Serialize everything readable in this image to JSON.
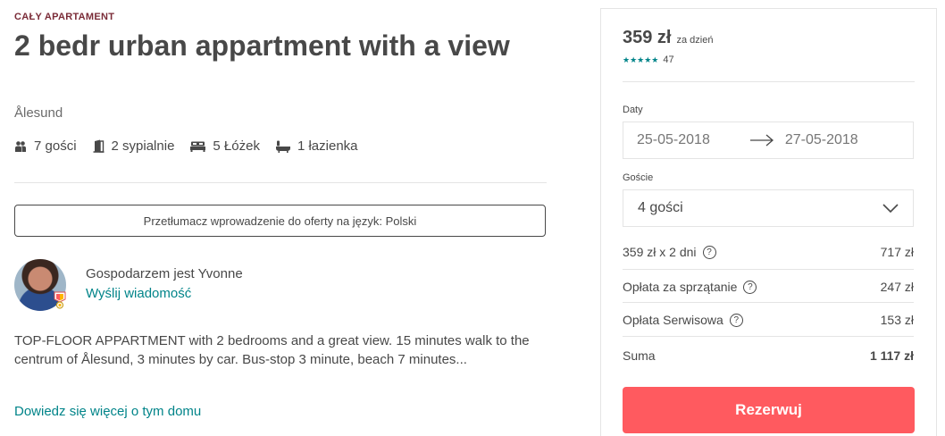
{
  "listing": {
    "type": "CAŁY APARTAMENT",
    "title": "2 bedr urban appartment with a view",
    "city": "Ålesund",
    "facts": {
      "guests": "7 gości",
      "bedrooms": "2 sypialnie",
      "beds": "5 Łóżek",
      "bathrooms": "1 łazienka"
    },
    "translate_label": "Przetłumacz wprowadzenie do oferty na język: Polski",
    "host": {
      "name": "Gospodarzem jest Yvonne",
      "message_link": "Wyślij wiadomość",
      "badge_icon": "superhost-badge-icon"
    },
    "description": "TOP-FLOOR APPARTMENT with 2 bedrooms and a great view. 15 minutes walk to the centrum of Ålesund, 3 minutes by car. Bus-stop 3 minute, beach 7 minutes...",
    "more_link": "Dowiedz się więcej o tym domu"
  },
  "booking": {
    "price": "359 zł",
    "price_unit": "za dzień",
    "stars": "★★★★★",
    "review_count": "47",
    "dates_label": "Daty",
    "checkin": "25-05-2018",
    "checkout": "27-05-2018",
    "guests_label": "Goście",
    "guests_value": "4 gości",
    "rows": {
      "nights_label": "359 zł x 2 dni",
      "nights_value": "717 zł",
      "cleaning_label": "Opłata za sprzątanie",
      "cleaning_value": "247 zł",
      "service_label": "Opłata Serwisowa",
      "service_value": "153 zł",
      "total_label": "Suma",
      "total_value": "1 117 zł"
    },
    "reserve_label": "Rezerwuj"
  },
  "colors": {
    "accent": "#ff5a5f",
    "link": "#008489",
    "text": "#484848",
    "eyebrow": "#7a2b37"
  }
}
